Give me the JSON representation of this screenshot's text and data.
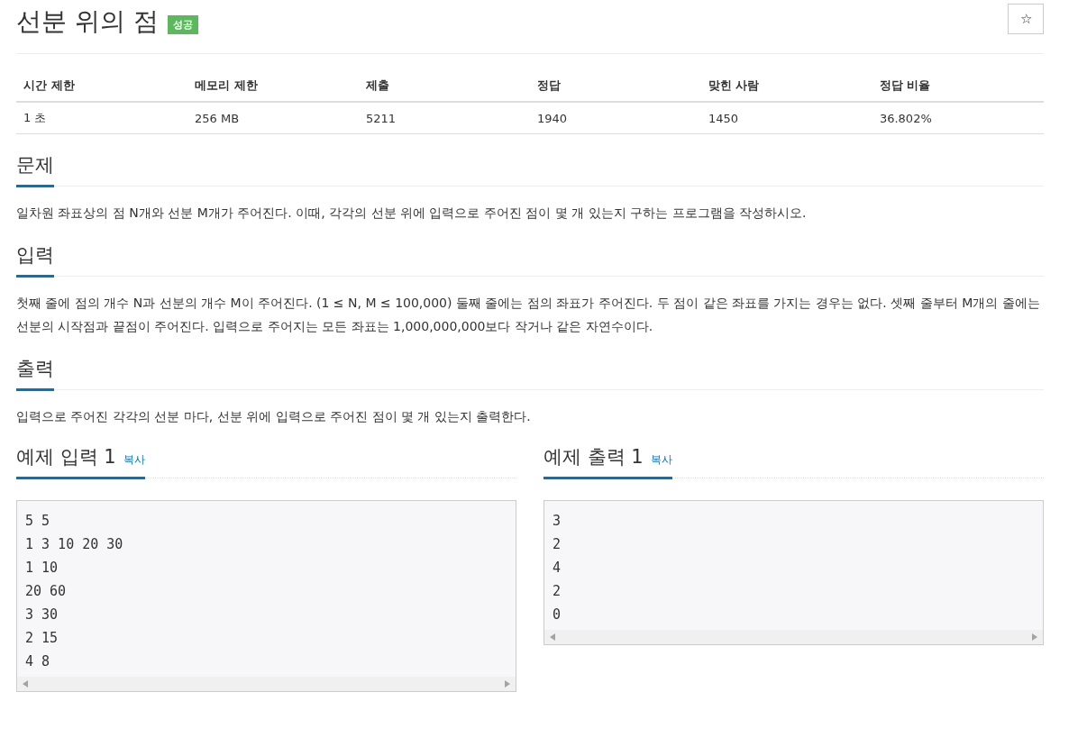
{
  "title": "선분 위의 점",
  "result_badge": "성공",
  "star_button": "☆",
  "info_table": {
    "columns": [
      "시간 제한",
      "메모리 제한",
      "제출",
      "정답",
      "맞힌 사람",
      "정답 비율"
    ],
    "rows": [
      [
        "1 초",
        "256 MB",
        "5211",
        "1940",
        "1450",
        "36.802%"
      ]
    ]
  },
  "sections": [
    {
      "heading": "문제",
      "text": "일차원 좌표상의 점 N개와 선분 M개가 주어진다. 이때, 각각의 선분 위에 입력으로 주어진 점이 몇 개 있는지 구하는 프로그램을 작성하시오."
    },
    {
      "heading": "입력",
      "text": "첫째 줄에 점의 개수 N과 선분의 개수 M이 주어진다. (1 ≤ N, M ≤ 100,000) 둘째 줄에는 점의 좌표가 주어진다. 두 점이 같은 좌표를 가지는 경우는 없다. 셋째 줄부터 M개의 줄에는 선분의 시작점과 끝점이 주어진다. 입력으로 주어지는 모든 좌표는 1,000,000,000보다 작거나 같은 자연수이다."
    },
    {
      "heading": "출력",
      "text": "입력으로 주어진 각각의 선분 마다, 선분 위에 입력으로 주어진 점이 몇 개 있는지 출력한다."
    }
  ],
  "samples": [
    {
      "heading": "예제 입력 1",
      "copy_link": "복사",
      "lines": [
        "5 5",
        "1 3 10 20 30",
        "1 10",
        "20 60",
        "3 30",
        "2 15",
        "4 8"
      ]
    },
    {
      "heading": "예제 출력 1",
      "copy_link": "복사",
      "lines": [
        "3",
        "2",
        "4",
        "2",
        "0"
      ]
    }
  ]
}
